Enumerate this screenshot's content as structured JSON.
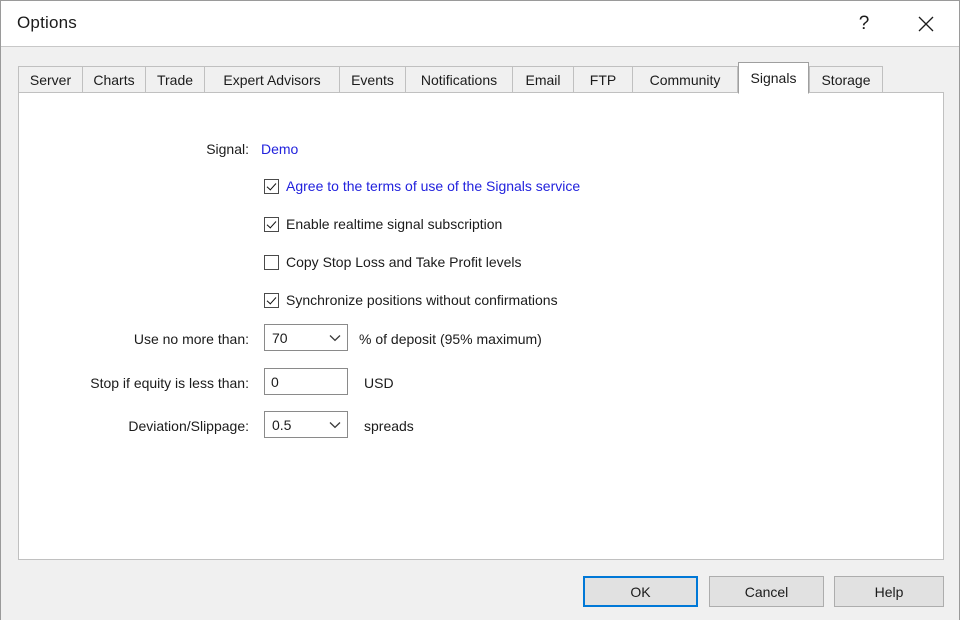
{
  "window": {
    "title": "Options",
    "help_icon": "question-mark-icon",
    "close_icon": "close-icon"
  },
  "tabs": [
    {
      "label": "Server",
      "active": false
    },
    {
      "label": "Charts",
      "active": false
    },
    {
      "label": "Trade",
      "active": false
    },
    {
      "label": "Expert Advisors",
      "active": false
    },
    {
      "label": "Events",
      "active": false
    },
    {
      "label": "Notifications",
      "active": false
    },
    {
      "label": "Email",
      "active": false
    },
    {
      "label": "FTP",
      "active": false
    },
    {
      "label": "Community",
      "active": false
    },
    {
      "label": "Signals",
      "active": true
    },
    {
      "label": "Storage",
      "active": false
    }
  ],
  "signals_panel": {
    "signal_label": "Signal:",
    "signal_value": "Demo",
    "signal_value_color": "#2222dd",
    "checkboxes": [
      {
        "label": "Agree to the terms of use of the Signals service",
        "checked": true,
        "is_link": true
      },
      {
        "label": "Enable realtime signal subscription",
        "checked": true,
        "is_link": false
      },
      {
        "label": "Copy Stop Loss and Take Profit levels",
        "checked": false,
        "is_link": false
      },
      {
        "label": "Synchronize positions without confirmations",
        "checked": true,
        "is_link": false
      }
    ],
    "use_no_more_than": {
      "label": "Use no more than:",
      "value": "70",
      "suffix": "% of deposit (95% maximum)",
      "arrow_icon": "chevron-down-icon"
    },
    "stop_if_equity": {
      "label": "Stop if equity is less than:",
      "value": "0",
      "placeholder": "0",
      "suffix": "USD"
    },
    "deviation_slippage": {
      "label": "Deviation/Slippage:",
      "value": "0.5",
      "suffix": "spreads",
      "arrow_icon": "chevron-down-icon"
    }
  },
  "footer": {
    "ok": "OK",
    "cancel": "Cancel",
    "help": "Help",
    "default_button": "OK",
    "focus_color": "#0078d7"
  }
}
